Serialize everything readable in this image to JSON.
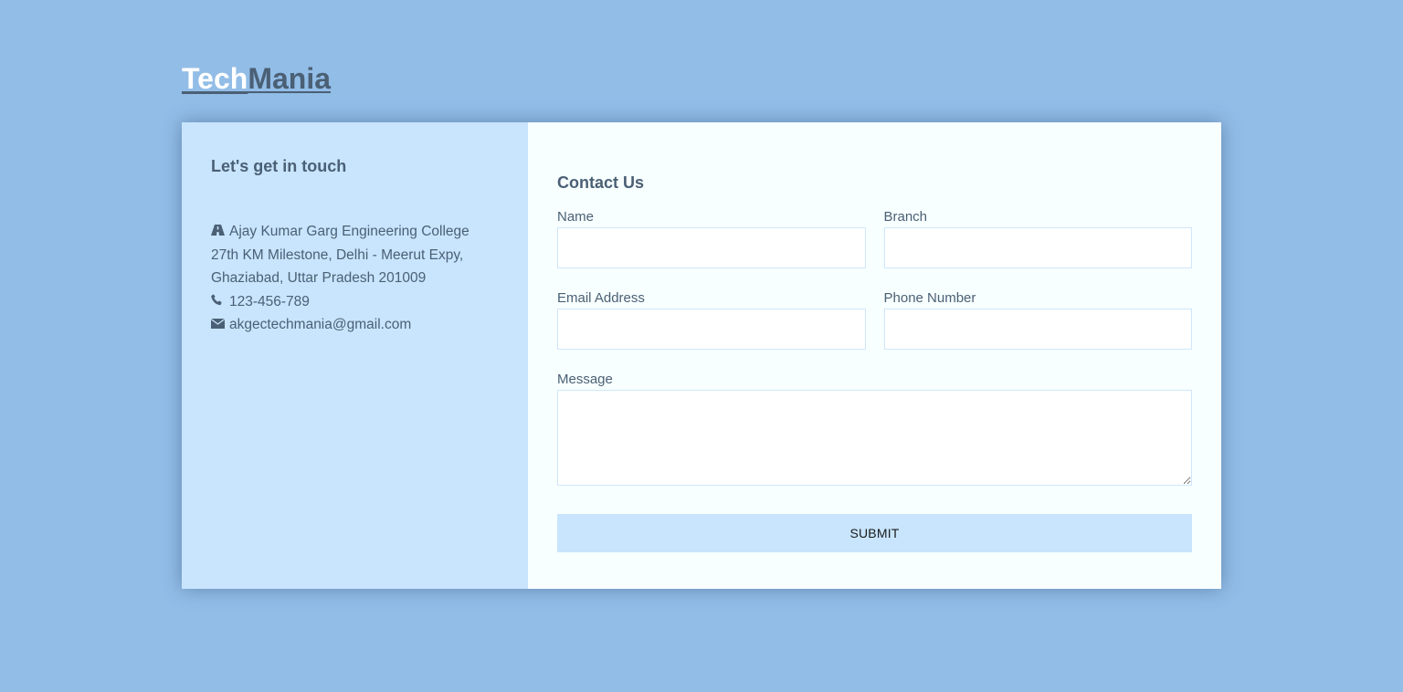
{
  "brand": {
    "part1": "Tech",
    "part2": "Mania"
  },
  "info": {
    "heading": "Let's get in touch",
    "address_line1": "Ajay Kumar Garg Engineering College",
    "address_line2": "27th KM Milestone, Delhi - Meerut Expy,",
    "address_line3": "Ghaziabad, Uttar Pradesh 201009",
    "phone": "123-456-789",
    "email": "akgectechmania@gmail.com",
    "icons": {
      "address": "road-icon",
      "phone": "phone-icon",
      "email": "envelope-icon"
    }
  },
  "form": {
    "heading": "Contact Us",
    "name_label": "Name",
    "name_value": "",
    "branch_label": "Branch",
    "branch_value": "",
    "email_label": "Email Address",
    "email_value": "",
    "phone_label": "Phone Number",
    "phone_value": "",
    "message_label": "Message",
    "message_value": "",
    "submit_label": "SUBMIT"
  },
  "colors": {
    "page_bg": "#92bde7",
    "info_bg": "#c8e5fd",
    "form_bg": "#f7ffff",
    "text": "#4b6075",
    "button_bg": "#c8e5fd"
  }
}
